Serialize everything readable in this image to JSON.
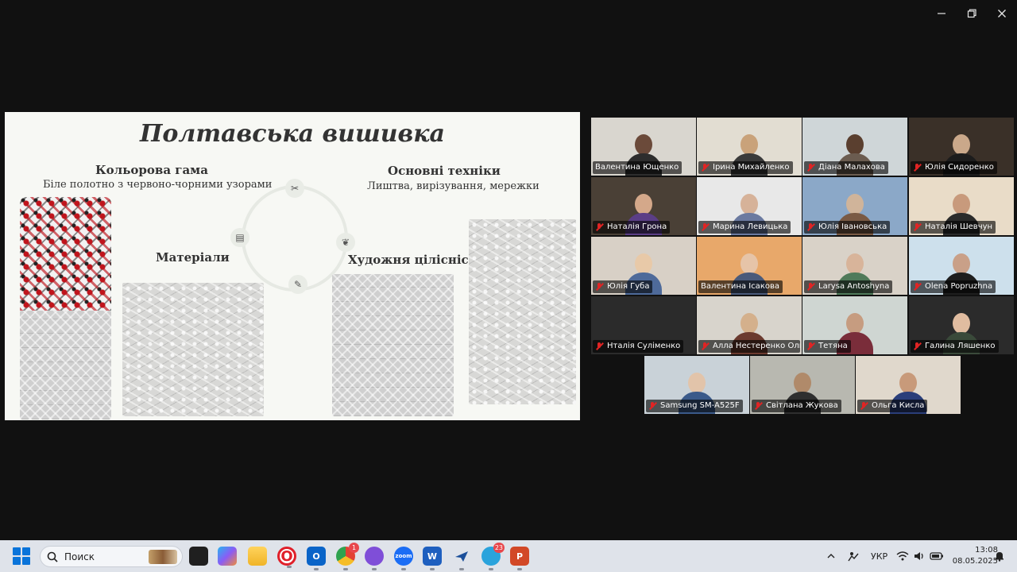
{
  "slide": {
    "title": "Полтавська вишивка",
    "color": {
      "heading": "Кольорова гама",
      "sub": "Біле полотно з червоно-чорними узорами"
    },
    "techniques": {
      "heading": "Основні техніки",
      "sub": "Лиштва, вирізування, мережки"
    },
    "materials": {
      "heading": "Матеріали"
    },
    "integrity": {
      "heading": "Художня цілісність"
    },
    "icons": [
      "scissors-icon",
      "palette-icon",
      "leaf-icon",
      "needle-icon"
    ]
  },
  "participants": [
    {
      "name": "Валентина Ющенко",
      "muted": false,
      "active": false
    },
    {
      "name": "Ірина Михайленко",
      "muted": true,
      "active": false
    },
    {
      "name": "Діана Малахова",
      "muted": true,
      "active": false
    },
    {
      "name": "Юлія Сидоренко",
      "muted": true,
      "active": false
    },
    {
      "name": "Наталія Грона",
      "muted": true,
      "active": false
    },
    {
      "name": "Марина Левицька",
      "muted": true,
      "active": false
    },
    {
      "name": "Юлія Івановська",
      "muted": true,
      "active": false
    },
    {
      "name": "Наталія Шевчун",
      "muted": true,
      "active": false
    },
    {
      "name": "Юлія Губа",
      "muted": true,
      "active": false
    },
    {
      "name": "Валентина Ісакова",
      "muted": false,
      "active": true
    },
    {
      "name": "Larysa Antoshyna",
      "muted": true,
      "active": false
    },
    {
      "name": "Olena Popruzhna",
      "muted": true,
      "active": false
    },
    {
      "name": "Нталія Суліменко",
      "muted": true,
      "active": false
    },
    {
      "name": "Алла Нестеренко Оль...",
      "muted": true,
      "active": false
    },
    {
      "name": "Тетяна",
      "muted": true,
      "active": false
    },
    {
      "name": "Галина Ляшенко",
      "muted": true,
      "active": false
    },
    {
      "name": "Samsung SM-A525F",
      "muted": true,
      "active": false
    },
    {
      "name": "Світлана Жукова",
      "muted": true,
      "active": false
    },
    {
      "name": "Ольга Кисла",
      "muted": true,
      "active": false
    }
  ],
  "taskbar": {
    "search_placeholder": "Поиск",
    "apps": [
      {
        "name": "task-view-icon",
        "label": ""
      },
      {
        "name": "copilot-icon",
        "label": ""
      },
      {
        "name": "file-explorer-icon",
        "label": ""
      },
      {
        "name": "opera-icon",
        "label": "O"
      },
      {
        "name": "outlook-icon",
        "label": "O"
      },
      {
        "name": "chrome-icon",
        "label": "",
        "badge": "1"
      },
      {
        "name": "viber-icon",
        "label": ""
      },
      {
        "name": "zoom-icon",
        "label": "zoom"
      },
      {
        "name": "word-icon",
        "label": "W"
      },
      {
        "name": "teams-flow-icon",
        "label": ""
      },
      {
        "name": "telegram-icon",
        "label": "",
        "badge": "23"
      },
      {
        "name": "powerpoint-icon",
        "label": "P"
      }
    ],
    "language": "УКР",
    "time": "13:08",
    "date": "08.05.2025"
  },
  "colors": {
    "accent_active": "#2ecc71",
    "muted_red": "#e02424",
    "taskbar_bg": "#dfe3ea"
  }
}
